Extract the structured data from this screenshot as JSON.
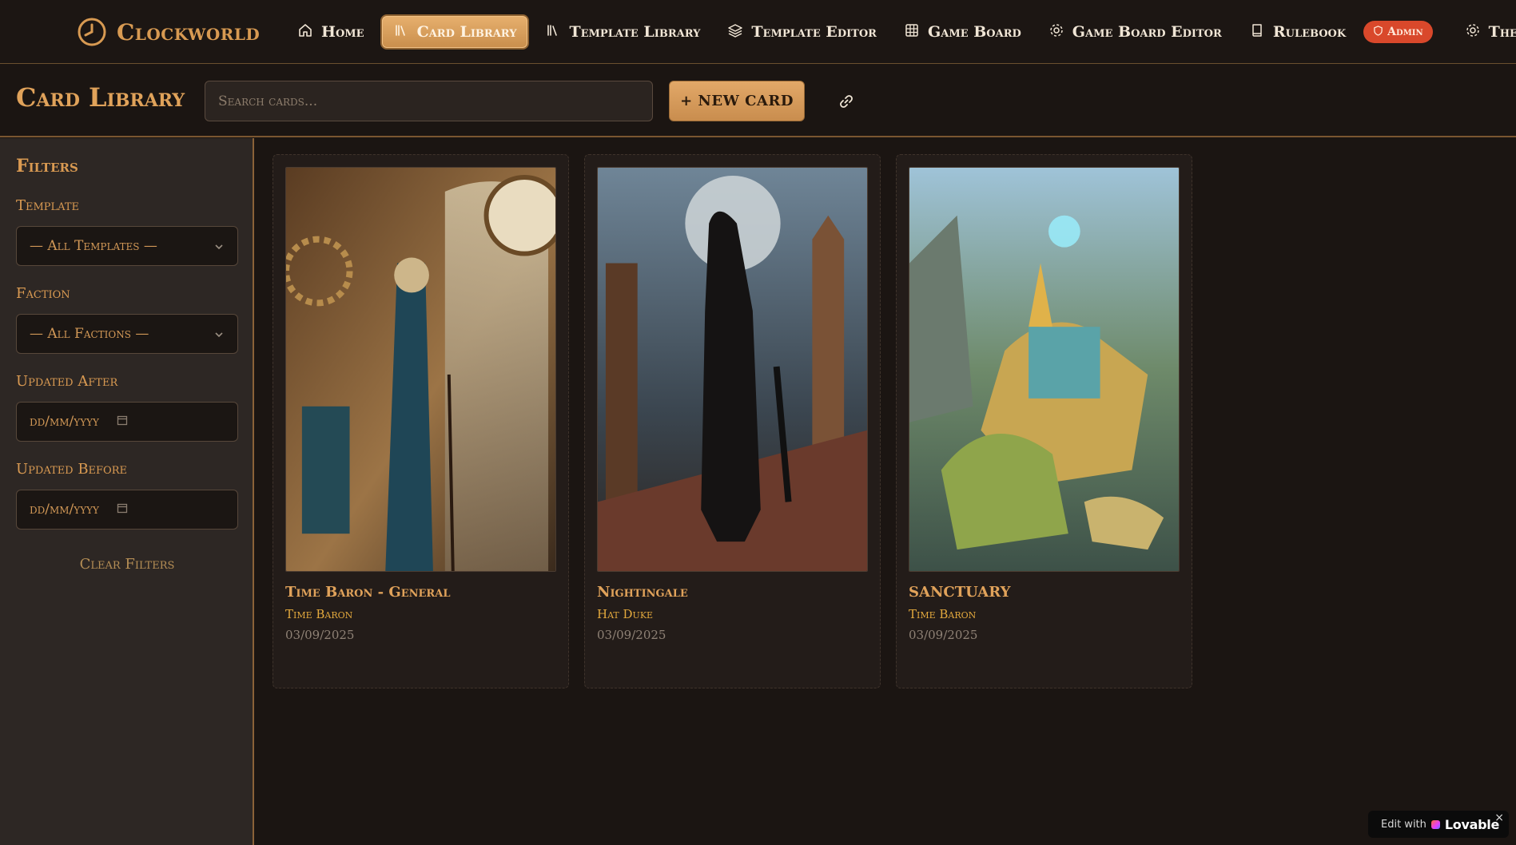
{
  "app": {
    "name": "Clockworld"
  },
  "nav": {
    "items": [
      {
        "label": "Home",
        "icon": "home-icon",
        "active": false
      },
      {
        "label": "Card Library",
        "icon": "library-icon",
        "active": true
      },
      {
        "label": "Template Library",
        "icon": "library-icon",
        "active": false
      },
      {
        "label": "Template Editor",
        "icon": "layers-icon",
        "active": false
      },
      {
        "label": "Game Board",
        "icon": "grid-icon",
        "active": false
      },
      {
        "label": "Game Board Editor",
        "icon": "gear-icon",
        "active": false
      },
      {
        "label": "Rulebook",
        "icon": "book-icon",
        "active": false
      }
    ],
    "admin_badge": "Admin",
    "overflow_item": "Theme"
  },
  "header": {
    "title": "Card Library",
    "search_placeholder": "Search cards...",
    "new_card_label": "+ NEW CARD"
  },
  "filters": {
    "title": "Filters",
    "template_label": "Template",
    "template_value": "— All Templates —",
    "faction_label": "Faction",
    "faction_value": "— All Factions —",
    "updated_after_label": "Updated After",
    "updated_after_placeholder": "dd/mm/yyyy",
    "updated_before_label": "Updated Before",
    "updated_before_placeholder": "dd/mm/yyyy",
    "clear_label": "Clear Filters"
  },
  "cards": [
    {
      "title": "Time Baron - General",
      "faction": "Time Baron",
      "updated": "03/09/2025"
    },
    {
      "title": "Nightingale",
      "faction": "Hat Duke",
      "updated": "03/09/2025"
    },
    {
      "title": "SANCTUARY",
      "faction": "Time Baron",
      "updated": "03/09/2025"
    }
  ],
  "badge": {
    "edit_text": "Edit with",
    "brand": "Lovable"
  },
  "colors": {
    "accent": "#d99a52",
    "active_nav": "#dfa663",
    "admin": "#d9482b",
    "background": "#1b1512",
    "sidebar": "#2d2724"
  }
}
